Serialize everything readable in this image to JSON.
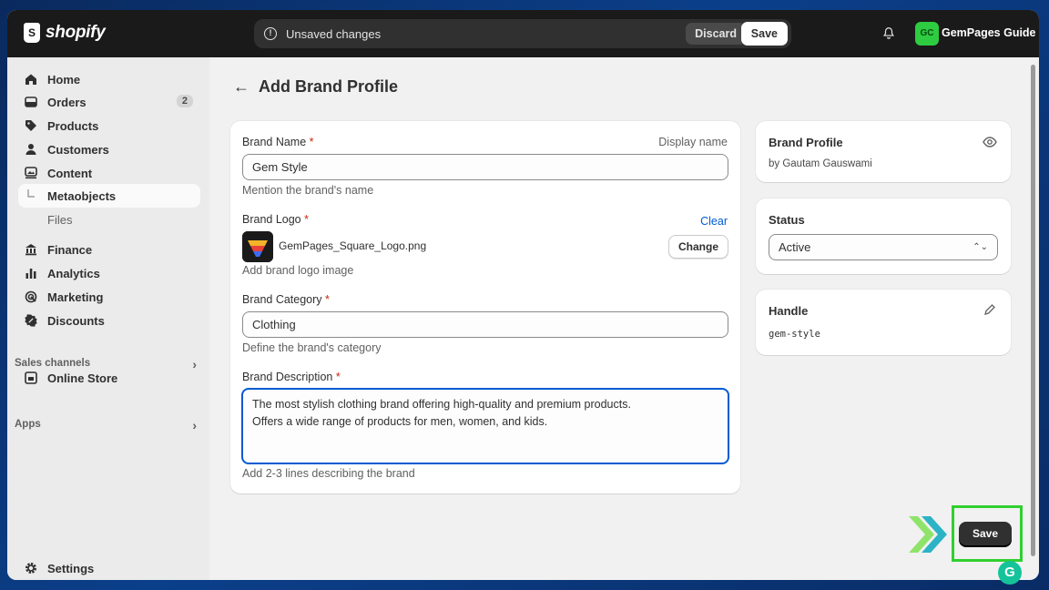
{
  "topbar": {
    "brand": "shopify",
    "unsaved_message": "Unsaved changes",
    "discard_label": "Discard",
    "save_label": "Save",
    "store_initials": "GC",
    "store_name": "GemPages Guide"
  },
  "sidebar": {
    "items": [
      {
        "label": "Home",
        "icon": "home-icon"
      },
      {
        "label": "Orders",
        "icon": "orders-icon",
        "badge": "2"
      },
      {
        "label": "Products",
        "icon": "tag-icon"
      },
      {
        "label": "Customers",
        "icon": "person-icon"
      },
      {
        "label": "Content",
        "icon": "content-icon"
      },
      {
        "label": "Metaobjects",
        "icon": "subitem-branch-icon"
      },
      {
        "label": "Files"
      },
      {
        "label": "Finance",
        "icon": "bank-icon"
      },
      {
        "label": "Analytics",
        "icon": "bar-chart-icon"
      },
      {
        "label": "Marketing",
        "icon": "target-icon"
      },
      {
        "label": "Discounts",
        "icon": "discount-icon"
      }
    ],
    "sales_channels_label": "Sales channels",
    "online_store_label": "Online Store",
    "apps_label": "Apps",
    "settings_label": "Settings"
  },
  "page": {
    "title": "Add Brand Profile"
  },
  "form": {
    "brand_name_label": "Brand Name",
    "required_mark": "*",
    "display_name_label": "Display name",
    "brand_name_value": "Gem Style",
    "brand_name_hint": "Mention the brand's name",
    "brand_logo_label": "Brand Logo",
    "clear_label": "Clear",
    "logo_filename": "GemPages_Square_Logo.png",
    "change_label": "Change",
    "brand_logo_hint": "Add brand logo image",
    "brand_category_label": "Brand Category",
    "brand_category_value": "Clothing",
    "brand_category_hint": "Define the brand's category",
    "brand_description_label": "Brand Description",
    "brand_description_value": "The most stylish clothing brand offering high-quality and premium products.\nOffers a wide range of products for men, women, and kids.",
    "brand_description_hint": "Add 2-3 lines describing the brand"
  },
  "side_cards": {
    "profile_title": "Brand Profile",
    "profile_author": "by Gautam Gauswami",
    "status_title": "Status",
    "status_value": "Active",
    "handle_title": "Handle",
    "handle_value": "gem-style"
  },
  "bottom": {
    "save_label": "Save"
  },
  "colors": {
    "accent_blue": "#005bd3",
    "highlight_green": "#2fd02f",
    "topbar_bg": "#1a1a1a"
  }
}
